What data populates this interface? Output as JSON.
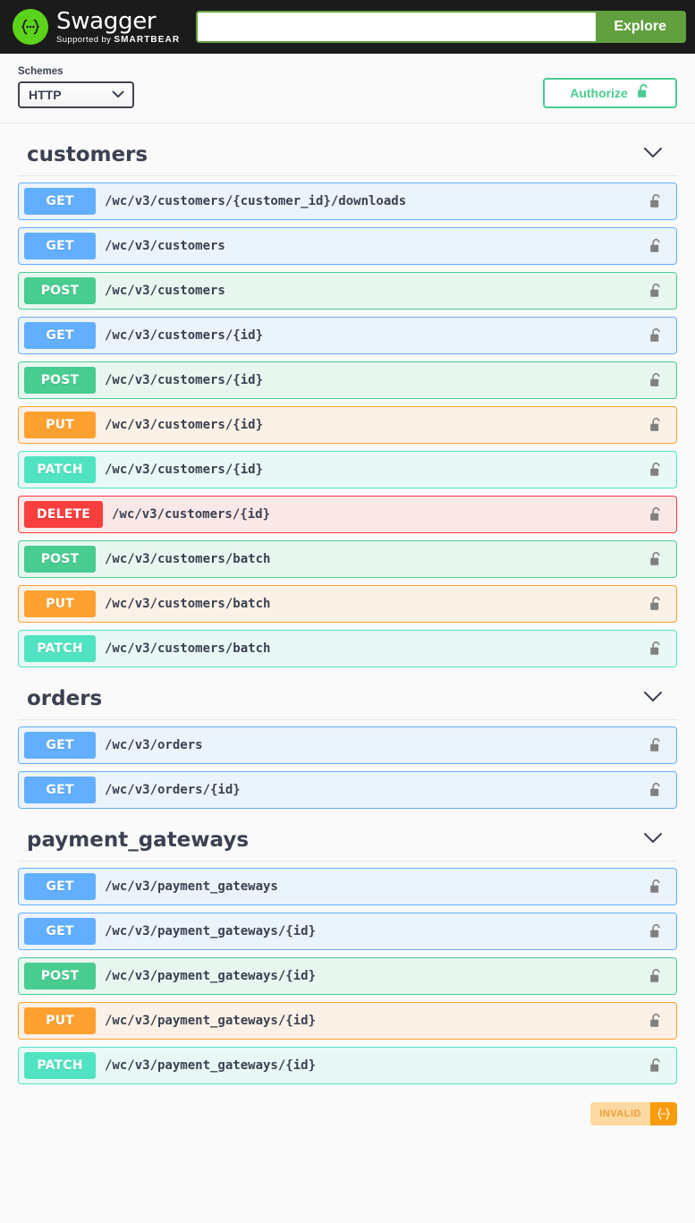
{
  "header": {
    "logo_title": "Swagger",
    "logo_supported_prefix": "Supported by ",
    "logo_supported_brand": "SMARTBEAR",
    "logo_icon": "swagger-braces-icon",
    "search_value": "",
    "search_placeholder": "",
    "explore_label": "Explore"
  },
  "scheme_bar": {
    "schemes_label": "Schemes",
    "scheme_value": "HTTP",
    "scheme_options": [
      "HTTP"
    ],
    "authorize_label": "Authorize",
    "authorize_icon": "unlocked-padlock-icon"
  },
  "colors": {
    "get": "#61affe",
    "post": "#49cc90",
    "put": "#fca130",
    "patch": "#50e3c2",
    "delete": "#f93e3e",
    "brand_green": "#62a03f",
    "logo_green": "#5bd31b",
    "authorize_green": "#49cc90",
    "validator_orange": "#f89b0c"
  },
  "sections": [
    {
      "title": "customers",
      "collapse_icon": "chevron-down-icon",
      "operations": [
        {
          "method": "GET",
          "path": "/wc/v3/customers/{customer_id}/downloads",
          "lock_icon": "unlocked-padlock-icon"
        },
        {
          "method": "GET",
          "path": "/wc/v3/customers",
          "lock_icon": "unlocked-padlock-icon"
        },
        {
          "method": "POST",
          "path": "/wc/v3/customers",
          "lock_icon": "unlocked-padlock-icon"
        },
        {
          "method": "GET",
          "path": "/wc/v3/customers/{id}",
          "lock_icon": "unlocked-padlock-icon"
        },
        {
          "method": "POST",
          "path": "/wc/v3/customers/{id}",
          "lock_icon": "unlocked-padlock-icon"
        },
        {
          "method": "PUT",
          "path": "/wc/v3/customers/{id}",
          "lock_icon": "unlocked-padlock-icon"
        },
        {
          "method": "PATCH",
          "path": "/wc/v3/customers/{id}",
          "lock_icon": "unlocked-padlock-icon"
        },
        {
          "method": "DELETE",
          "path": "/wc/v3/customers/{id}",
          "lock_icon": "unlocked-padlock-icon"
        },
        {
          "method": "POST",
          "path": "/wc/v3/customers/batch",
          "lock_icon": "unlocked-padlock-icon"
        },
        {
          "method": "PUT",
          "path": "/wc/v3/customers/batch",
          "lock_icon": "unlocked-padlock-icon"
        },
        {
          "method": "PATCH",
          "path": "/wc/v3/customers/batch",
          "lock_icon": "unlocked-padlock-icon"
        }
      ]
    },
    {
      "title": "orders",
      "collapse_icon": "chevron-down-icon",
      "operations": [
        {
          "method": "GET",
          "path": "/wc/v3/orders",
          "lock_icon": "unlocked-padlock-icon"
        },
        {
          "method": "GET",
          "path": "/wc/v3/orders/{id}",
          "lock_icon": "unlocked-padlock-icon"
        }
      ]
    },
    {
      "title": "payment_gateways",
      "collapse_icon": "chevron-down-icon",
      "operations": [
        {
          "method": "GET",
          "path": "/wc/v3/payment_gateways",
          "lock_icon": "unlocked-padlock-icon"
        },
        {
          "method": "GET",
          "path": "/wc/v3/payment_gateways/{id}",
          "lock_icon": "unlocked-padlock-icon"
        },
        {
          "method": "POST",
          "path": "/wc/v3/payment_gateways/{id}",
          "lock_icon": "unlocked-padlock-icon"
        },
        {
          "method": "PUT",
          "path": "/wc/v3/payment_gateways/{id}",
          "lock_icon": "unlocked-padlock-icon"
        },
        {
          "method": "PATCH",
          "path": "/wc/v3/payment_gateways/{id}",
          "lock_icon": "unlocked-padlock-icon"
        }
      ]
    }
  ],
  "validator": {
    "label": "INVALID",
    "icon": "swagger-braces-icon"
  }
}
